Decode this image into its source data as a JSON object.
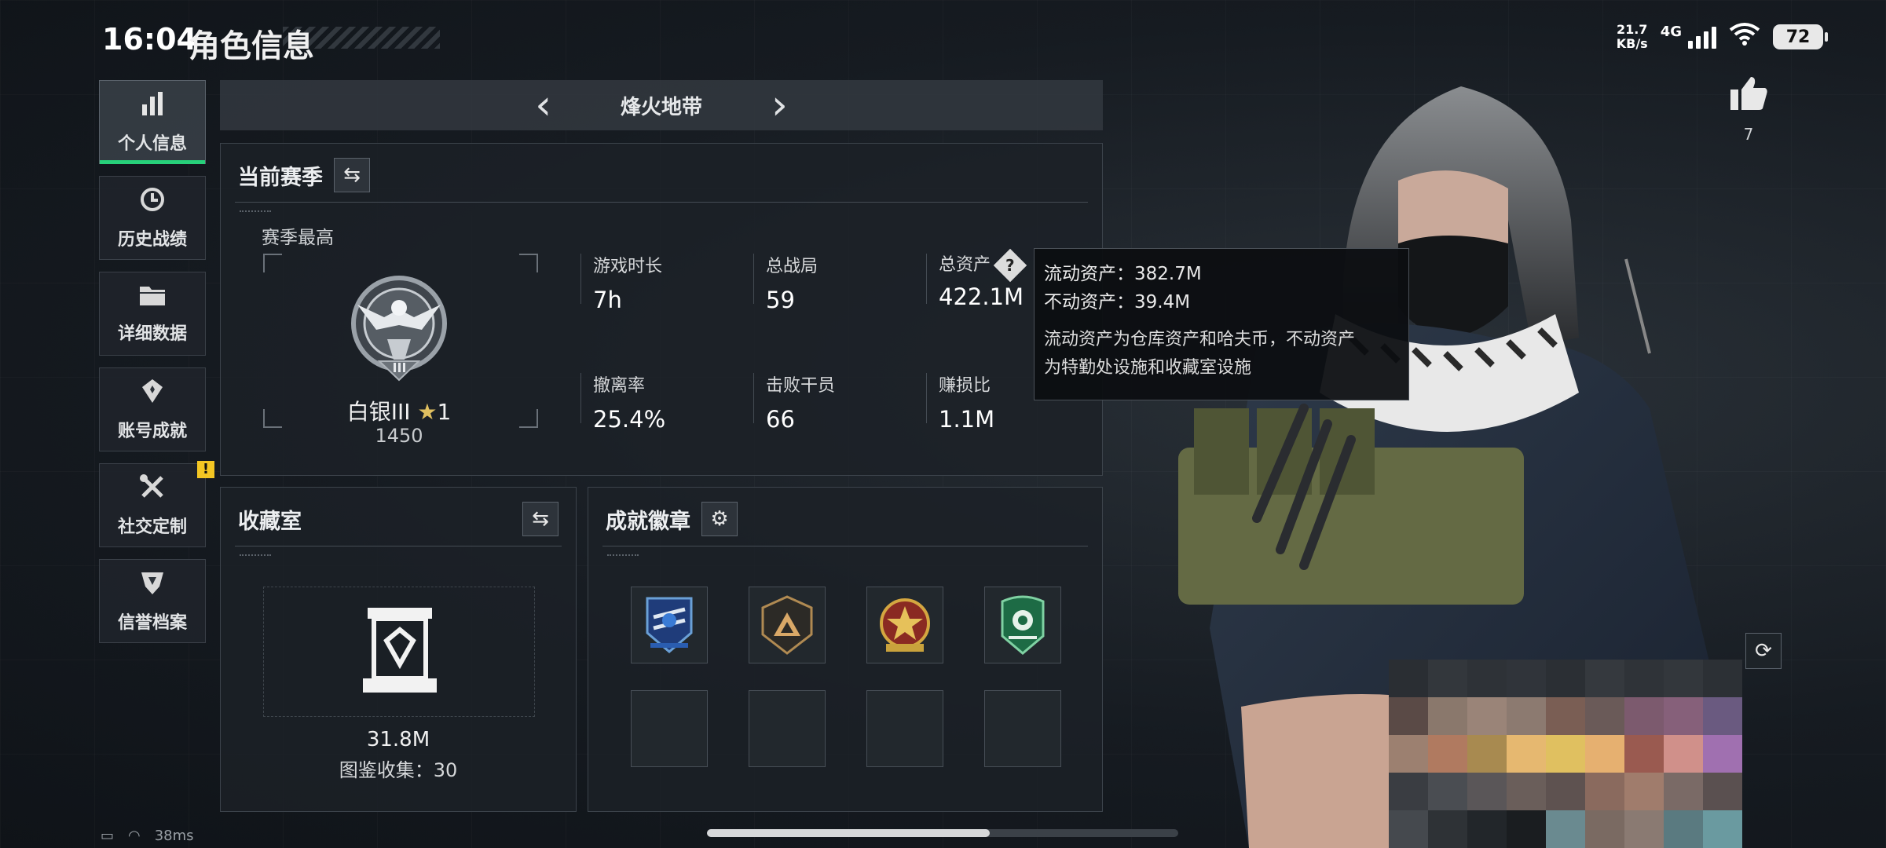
{
  "status_bar": {
    "time": "16:04",
    "net_speed": "21.7",
    "net_speed_unit": "KB/s",
    "net_type": "4G",
    "battery": "72"
  },
  "page_title": "角色信息",
  "sidebar": {
    "items": [
      {
        "label": "个人信息",
        "icon": "bar-chart-icon"
      },
      {
        "label": "历史战绩",
        "icon": "history-clock-icon"
      },
      {
        "label": "详细数据",
        "icon": "folder-icon"
      },
      {
        "label": "账号成就",
        "icon": "achievement-medal-icon"
      },
      {
        "label": "社交定制",
        "icon": "wrench-screwdriver-icon",
        "badge": "!"
      },
      {
        "label": "信誉档案",
        "icon": "shield-emblem-icon"
      }
    ]
  },
  "mode_nav": {
    "title": "烽火地带"
  },
  "season": {
    "title": "当前赛季",
    "subtitle": "赛季最高",
    "rank_name": "白银III",
    "rank_star": "★",
    "rank_star_count": "1",
    "rank_points": "1450",
    "stats": [
      {
        "label": "游戏时长",
        "value": "7h"
      },
      {
        "label": "总战局",
        "value": "59"
      },
      {
        "label": "总资产",
        "value": "422.1M",
        "help": "?"
      },
      {
        "label": "撤离率",
        "value": "25.4%"
      },
      {
        "label": "击败干员",
        "value": "66"
      },
      {
        "label": "赚损比",
        "value": "1.1M"
      }
    ]
  },
  "tooltip": {
    "liquid": "流动资产：382.7M",
    "fixed": "不动资产：39.4M",
    "note_line1": "流动资产为仓库资产和哈夫币，不动资产",
    "note_line2": "为特勤处设施和收藏室设施"
  },
  "collection": {
    "title": "收藏室",
    "value": "31.8M",
    "count": "图鉴收集：30"
  },
  "badges": {
    "title": "成就徽章",
    "items": [
      "badge-blue-wings-icon",
      "badge-bronze-triangle-icon",
      "badge-red-star-icon",
      "badge-green-shield-icon"
    ]
  },
  "profile": {
    "like_count": "7"
  },
  "bottom": {
    "ping": "38ms"
  },
  "colors": {
    "active_accent": "#27d07a",
    "warning_badge": "#f3c623"
  }
}
